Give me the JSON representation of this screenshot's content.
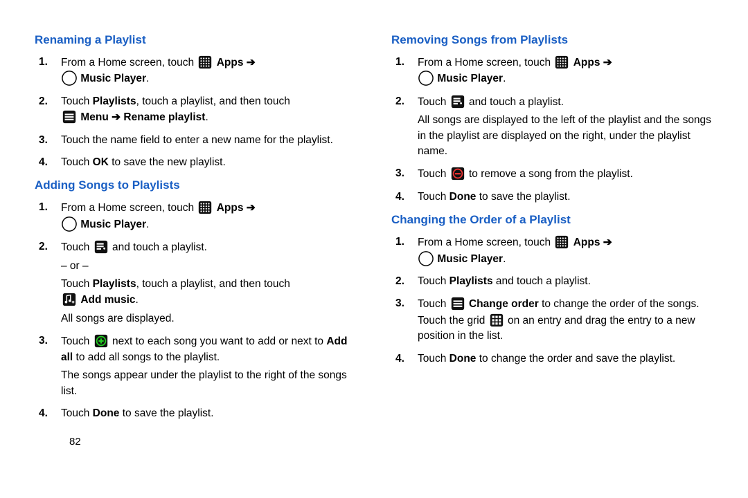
{
  "pageNumber": "82",
  "arrow": "➔",
  "or": "– or –",
  "labels": {
    "apps": "Apps",
    "musicPlayer": "Music Player",
    "menu": "Menu",
    "renamePlaylist": "Rename playlist",
    "playlists": "Playlists",
    "ok": "OK",
    "addMusic": "Add music",
    "addAll": "Add all",
    "done": "Done",
    "changeOrder": "Change order"
  },
  "sections": {
    "rename": {
      "title": "Renaming a Playlist",
      "steps": {
        "s1a": "From a Home screen, touch ",
        "s2a": "Touch ",
        "s2b": ", touch a playlist, and then touch ",
        "s3": "Touch the name field to enter a new name for the playlist.",
        "s4a": "Touch ",
        "s4b": " to save the new playlist."
      }
    },
    "adding": {
      "title": "Adding Songs to Playlists",
      "steps": {
        "s1a": "From a Home screen, touch ",
        "s2a": "Touch ",
        "s2b": " and touch a playlist.",
        "s2c": "Touch ",
        "s2d": ", touch a playlist, and then touch ",
        "s2e": "All songs are displayed.",
        "s3a": "Touch ",
        "s3b": " next to each song you want to add or next to ",
        "s3c": " to add all songs to the playlist.",
        "s3d": "The songs appear under the playlist to the right of the songs list.",
        "s4a": "Touch ",
        "s4b": " to save the playlist."
      }
    },
    "removing": {
      "title": "Removing Songs from Playlists",
      "steps": {
        "s1a": "From a Home screen, touch ",
        "s2a": "Touch ",
        "s2b": " and touch a playlist.",
        "s2c": "All songs are displayed to the left of the playlist and the songs in the playlist are displayed on the right, under the playlist name.",
        "s3a": "Touch ",
        "s3b": " to remove a song from the playlist.",
        "s4a": "Touch ",
        "s4b": " to save the playlist."
      }
    },
    "changing": {
      "title": "Changing the Order of a Playlist",
      "steps": {
        "s1a": "From a Home screen, touch ",
        "s2a": "Touch ",
        "s2b": " and touch a playlist.",
        "s3a": "Touch ",
        "s3b": " to change the order of the songs. Touch the grid ",
        "s3c": " on an entry and drag the entry to a new position in the list.",
        "s4a": "Touch ",
        "s4b": " to change the order and save the playlist."
      }
    }
  }
}
